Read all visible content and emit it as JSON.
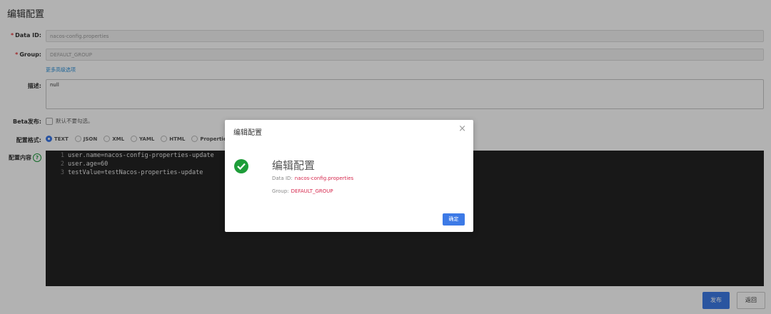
{
  "page": {
    "title": "编辑配置",
    "data_id": {
      "label": "Data ID:",
      "required": "*",
      "value": "nacos-config.properties"
    },
    "group": {
      "label": "Group:",
      "required": "*",
      "value": "DEFAULT_GROUP"
    },
    "advanced_link": "更多高级选项",
    "description": {
      "label": "描述:",
      "value": "null"
    },
    "beta": {
      "label": "Beta发布:",
      "checkbox_label": "默认不要勾选。"
    },
    "format": {
      "label": "配置格式:",
      "options": [
        "TEXT",
        "JSON",
        "XML",
        "YAML",
        "HTML",
        "Properties"
      ],
      "selected": "TEXT"
    },
    "content": {
      "label": "配置内容",
      "help_icon": "question-circle-icon",
      "lines": [
        {
          "num": "1",
          "text": "user.name=nacos-config-properties-update"
        },
        {
          "num": "2",
          "text": "user.age=60"
        },
        {
          "num": "3",
          "text": "testValue=testNacos-properties-update"
        }
      ]
    },
    "publish_button": "发布",
    "back_button": "返回"
  },
  "dialog": {
    "title": "编辑配置",
    "close_icon": "close-icon",
    "success_icon": "check-circle-icon",
    "message_title": "编辑配置",
    "data_id_label": "Data ID:",
    "data_id_value": "nacos-config.properties",
    "group_label": "Group:",
    "group_value": "DEFAULT_GROUP",
    "ok_button": "确定"
  },
  "colors": {
    "primary": "#3d7ae6",
    "success": "#1e9d39",
    "required": "#e4393c",
    "link": "#2a8fd7",
    "editor_bg": "#232323",
    "value_red": "#d6294e"
  }
}
